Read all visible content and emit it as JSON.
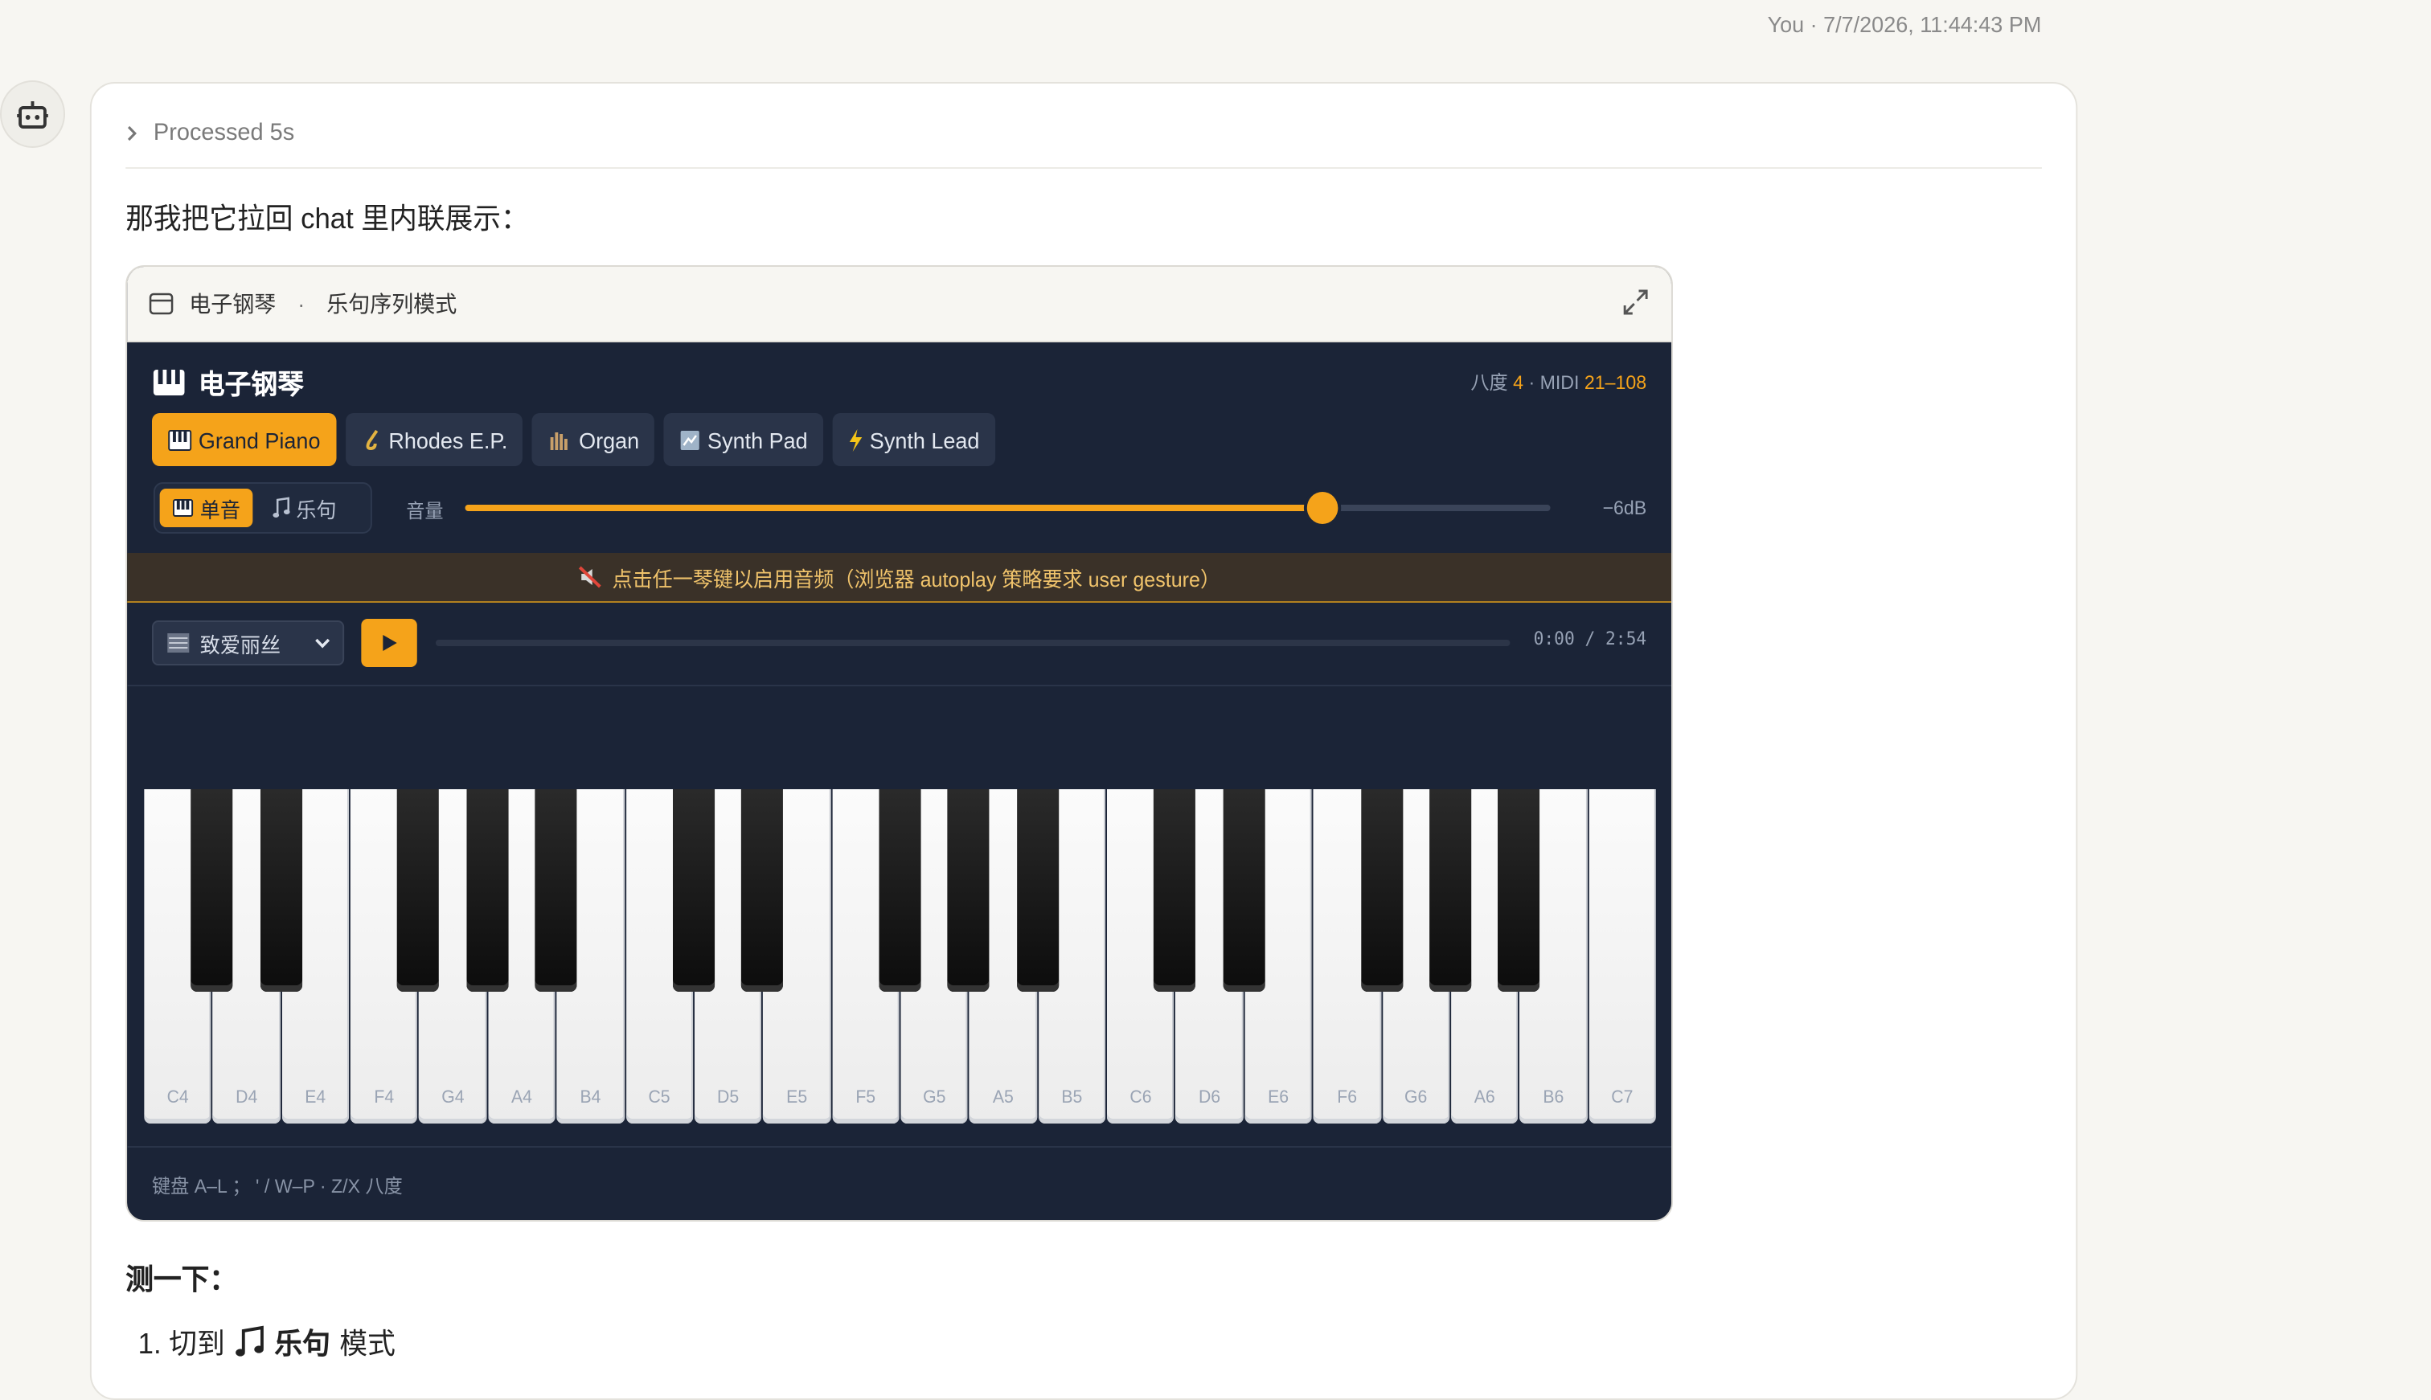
{
  "meta": {
    "author_time": "You · 7/7/2026, 11:44:43 PM"
  },
  "processed": {
    "label": "Processed 5s"
  },
  "intro_text": "那我把它拉回 chat 里内联展示：",
  "embed": {
    "title": "电子钢琴",
    "mode_title": "乐句序列模式"
  },
  "app": {
    "title": "电子钢琴",
    "range_prefix": "八度",
    "octave": "4",
    "midi_prefix": "· MIDI",
    "midi_range": "21–108",
    "instruments": [
      {
        "label": "Grand Piano",
        "icon": "piano-icon",
        "active": true
      },
      {
        "label": "Rhodes E.P.",
        "icon": "saxophone-icon",
        "active": false
      },
      {
        "label": "Organ",
        "icon": "organ-icon",
        "active": false
      },
      {
        "label": "Synth Pad",
        "icon": "pad-icon",
        "active": false
      },
      {
        "label": "Synth Lead",
        "icon": "lightning-icon",
        "active": false
      }
    ],
    "modes": [
      {
        "label": "单音",
        "icon": "piano-icon",
        "active": true
      },
      {
        "label": "乐句",
        "icon": "music-note-icon",
        "active": false
      }
    ],
    "volume": {
      "label": "音量",
      "db": "−6dB",
      "level": 0.79
    },
    "notice": "点击任一琴键以启用音频（浏览器 autoplay 策略要求 user gesture）",
    "player": {
      "song": "致爱丽丝",
      "time": "0:00 / 2:54",
      "progress": 0
    },
    "white_keys": [
      "C4",
      "D4",
      "E4",
      "F4",
      "G4",
      "A4",
      "B4",
      "C5",
      "D5",
      "E5",
      "F5",
      "G5",
      "A5",
      "B5",
      "C6",
      "D6",
      "E6",
      "F6",
      "G6",
      "A6",
      "B6",
      "C7"
    ],
    "black_key_after": [
      0,
      1,
      3,
      4,
      5,
      7,
      8,
      10,
      11,
      12,
      14,
      15,
      17,
      18,
      19
    ],
    "hint": "键盘 A–L ； ' / W–P · Z/X 八度",
    "colors": {
      "accent": "#f5a31a",
      "bg": "#1b2437"
    }
  },
  "test": {
    "title": "测一下：",
    "step1_prefix": "1. 切到",
    "step1_bold": "乐句",
    "step1_suffix": "模式"
  }
}
